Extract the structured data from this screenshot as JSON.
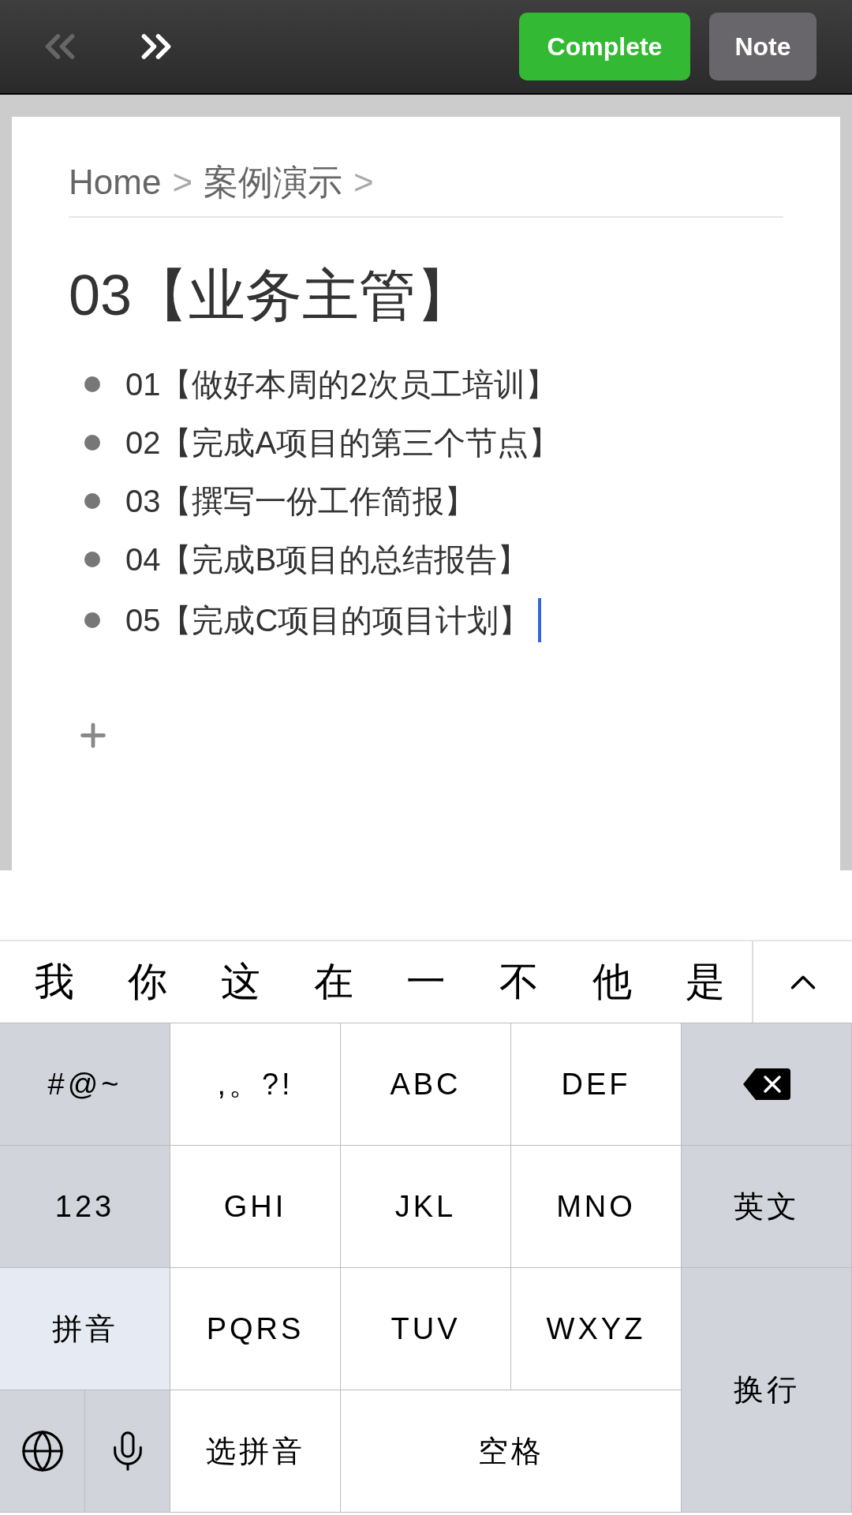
{
  "toolbar": {
    "nav": [
      {
        "kind": "back",
        "disabled": true
      },
      {
        "kind": "forward",
        "disabled": false
      }
    ],
    "buttons": [
      {
        "kind": "primary",
        "label": "Complete"
      },
      {
        "kind": "secondary",
        "label": "Note"
      }
    ]
  },
  "breadcrumb": {
    "separator": ">",
    "items": [
      "Home",
      "案例演示"
    ]
  },
  "title": "03【业务主管】",
  "items": [
    {
      "text": "01【做好本周的2次员工培训】",
      "cursor": false
    },
    {
      "text": "02【完成A项目的第三个节点】",
      "cursor": false
    },
    {
      "text": "03【撰写一份工作简报】",
      "cursor": false
    },
    {
      "text": "04【完成B项目的总结报告】",
      "cursor": false
    },
    {
      "text": "05【完成C项目的项目计划】",
      "cursor": true
    }
  ],
  "candidates": [
    "我",
    "你",
    "这",
    "在",
    "一",
    "不",
    "他",
    "是"
  ],
  "keys": [
    {
      "kind": "fn",
      "label": "#@~"
    },
    {
      "kind": "char",
      "label": ",。?!"
    },
    {
      "kind": "char",
      "label": "ABC"
    },
    {
      "kind": "char",
      "label": "DEF"
    },
    {
      "kind": "delete"
    },
    {
      "kind": "fn",
      "label": "123"
    },
    {
      "kind": "char",
      "label": "GHI"
    },
    {
      "kind": "char",
      "label": "JKL"
    },
    {
      "kind": "char",
      "label": "MNO"
    },
    {
      "kind": "fn",
      "label": "英文"
    },
    {
      "kind": "mode",
      "label": "拼音"
    },
    {
      "kind": "char",
      "label": "PQRS"
    },
    {
      "kind": "char",
      "label": "TUV"
    },
    {
      "kind": "char",
      "label": "WXYZ"
    },
    {
      "kind": "return",
      "label": "换行"
    },
    {
      "kind": "globe"
    },
    {
      "kind": "mic"
    },
    {
      "kind": "char",
      "label": "选拼音"
    },
    {
      "kind": "space",
      "label": "空格"
    }
  ]
}
